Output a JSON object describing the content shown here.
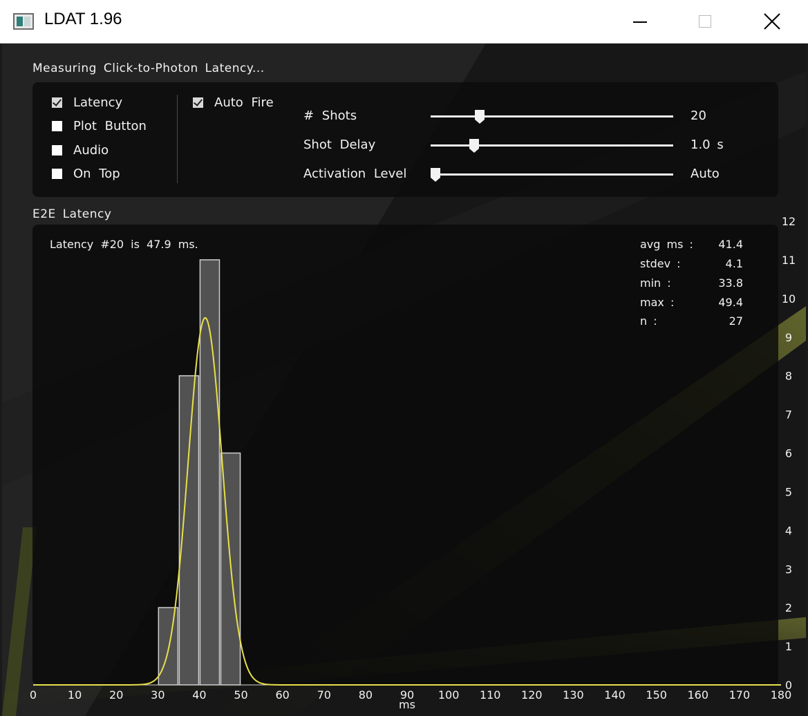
{
  "window": {
    "title": "LDAT 1.96",
    "min_icon": "minimize-icon",
    "max_icon": "maximize-icon",
    "close_icon": "close-icon"
  },
  "header": {
    "status": "Measuring Click-to-Photon Latency..."
  },
  "options": {
    "checkboxes": [
      {
        "label": "Latency",
        "checked": true
      },
      {
        "label": "Plot Button",
        "checked": false
      },
      {
        "label": "Audio",
        "checked": false
      },
      {
        "label": "On Top",
        "checked": false
      }
    ],
    "auto_fire": {
      "label": "Auto Fire",
      "checked": true
    },
    "sliders": [
      {
        "label": "# Shots",
        "value": "20",
        "position": 0.19
      },
      {
        "label": "Shot Delay",
        "value": "1.0 s",
        "position": 0.165
      },
      {
        "label": "Activation Level",
        "value": "Auto",
        "position": 0.0
      }
    ]
  },
  "chart_section": {
    "label": "E2E Latency"
  },
  "chart_data": {
    "type": "bar",
    "status": "Latency #20 is 47.9 ms.",
    "xlabel": "ms",
    "ylabel": "",
    "xlim": [
      0,
      180
    ],
    "ylim": [
      0,
      12
    ],
    "x_ticks": [
      "0",
      "10",
      "20",
      "30",
      "40",
      "50",
      "60",
      "70",
      "80",
      "90",
      "100",
      "110",
      "120",
      "130",
      "140",
      "150",
      "160",
      "170",
      "180"
    ],
    "y_ticks": [
      "0",
      "1",
      "2",
      "3",
      "4",
      "5",
      "6",
      "7",
      "8",
      "9",
      "10",
      "11",
      "12"
    ],
    "bins": [
      {
        "start": 30,
        "end": 35,
        "count": 2
      },
      {
        "start": 35,
        "end": 40,
        "count": 8
      },
      {
        "start": 40,
        "end": 45,
        "count": 11
      },
      {
        "start": 45,
        "end": 50,
        "count": 6
      }
    ],
    "curve": {
      "type": "normal-fit",
      "mean": 41.4,
      "stdev": 4.1,
      "peak": 9.5,
      "color": "#e8e04a"
    },
    "stats": [
      {
        "key": "avg ms :",
        "value": "41.4"
      },
      {
        "key": "stdev :",
        "value": "4.1"
      },
      {
        "key": "min :",
        "value": "33.8"
      },
      {
        "key": "max :",
        "value": "49.4"
      },
      {
        "key": "n :",
        "value": "27"
      }
    ],
    "grid": false
  },
  "colors": {
    "accent": "#e8e04a",
    "bar_fill": "#6a6a6a",
    "bar_stroke": "#cfcfcf",
    "text": "#f2f2f2"
  }
}
